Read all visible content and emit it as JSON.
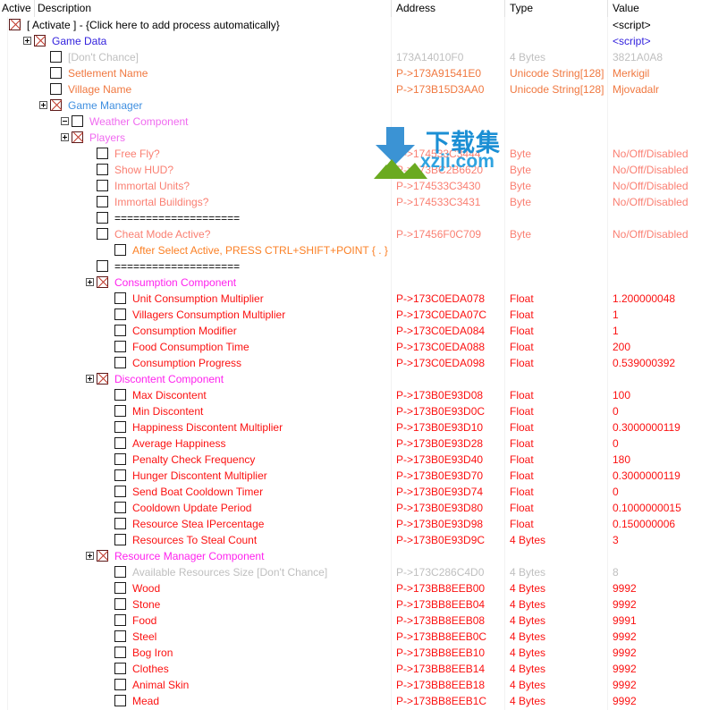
{
  "header": {
    "columns": [
      {
        "key": "active",
        "label": "Active"
      },
      {
        "key": "description",
        "label": "Description"
      },
      {
        "key": "address",
        "label": "Address"
      },
      {
        "key": "type",
        "label": "Type"
      },
      {
        "key": "value",
        "label": "Value"
      }
    ]
  },
  "colors": {
    "group_blue_violet": "#3322dd",
    "group_blue": "#3f8fe0",
    "group_violet": "#f06af0",
    "group_magenta": "#ff22ee",
    "entry_orange": "#f07840",
    "entry_salmon": "#fa7f72",
    "entry_red": "#fb1111",
    "entry_orange_bright": "#fb8026",
    "disabled_gray": "#bfbfbf",
    "text_black": "#000000",
    "check_red": "#c0392b",
    "watermark_blue": "#1b8fd4",
    "watermark_green": "#6aaa20"
  },
  "watermark": {
    "text_cn": "下载集",
    "text_url": "xzji.com"
  },
  "rows": [
    {
      "indent": 0,
      "checkbox": "x",
      "expander": null,
      "description": "[ Activate ] - {Click here to add process automatically}",
      "color": "text_black",
      "address": "",
      "type": "",
      "value": "<script>",
      "value_color": "text_black"
    },
    {
      "indent": 1,
      "checkbox": "x",
      "expander": "plus",
      "description": "Game Data",
      "color": "group_blue_violet",
      "address": "",
      "type": "",
      "value": "<script>",
      "value_color": "group_blue_violet"
    },
    {
      "indent": 2,
      "checkbox": "empty",
      "expander": null,
      "description": "[Don't Chance]",
      "color": "disabled_gray",
      "address": "173A14010F0",
      "type": "4 Bytes",
      "value": "3821A0A8",
      "value_color": "disabled_gray"
    },
    {
      "indent": 2,
      "checkbox": "empty",
      "expander": null,
      "description": "Setlement Name",
      "color": "entry_orange",
      "address": "P->173A91541E0",
      "type": "Unicode String[128]",
      "value": "Merkigil",
      "value_color": "entry_orange"
    },
    {
      "indent": 2,
      "checkbox": "empty",
      "expander": null,
      "description": "Village Name",
      "color": "entry_orange",
      "address": "P->173B15D3AA0",
      "type": "Unicode String[128]",
      "value": "Mjovadalr",
      "value_color": "entry_orange"
    },
    {
      "indent": 2,
      "checkbox": "x",
      "expander": "plus",
      "description": "Game Manager",
      "color": "group_blue",
      "address": "",
      "type": "",
      "value": "",
      "value_color": "group_blue"
    },
    {
      "indent": 3,
      "checkbox": "empty",
      "expander": "minus",
      "description": "Weather Component",
      "color": "group_violet",
      "address": "",
      "type": "",
      "value": "",
      "value_color": "group_violet"
    },
    {
      "indent": 3,
      "checkbox": "x",
      "expander": "plus",
      "description": "Players",
      "color": "group_violet",
      "address": "",
      "type": "",
      "value": "",
      "value_color": "group_violet"
    },
    {
      "indent": 4,
      "checkbox": "empty",
      "expander": null,
      "description": "Free Fly?",
      "color": "entry_salmon",
      "address": "P->174533C3444",
      "type": "Byte",
      "value": "No/Off/Disabled",
      "value_color": "entry_salmon"
    },
    {
      "indent": 4,
      "checkbox": "empty",
      "expander": null,
      "description": "Show HUD?",
      "color": "entry_salmon",
      "address": "P->173BC2B6620",
      "type": "Byte",
      "value": "No/Off/Disabled",
      "value_color": "entry_salmon"
    },
    {
      "indent": 4,
      "checkbox": "empty",
      "expander": null,
      "description": "Immortal Units?",
      "color": "entry_salmon",
      "address": "P->174533C3430",
      "type": "Byte",
      "value": "No/Off/Disabled",
      "value_color": "entry_salmon"
    },
    {
      "indent": 4,
      "checkbox": "empty",
      "expander": null,
      "description": "Immortal Buildings?",
      "color": "entry_salmon",
      "address": "P->174533C3431",
      "type": "Byte",
      "value": "No/Off/Disabled",
      "value_color": "entry_salmon"
    },
    {
      "indent": 4,
      "checkbox": "empty",
      "expander": null,
      "description": "====================",
      "color": "text_black",
      "address": "",
      "type": "",
      "value": "",
      "value_color": "text_black"
    },
    {
      "indent": 4,
      "checkbox": "empty",
      "expander": null,
      "description": "Cheat Mode Active?",
      "color": "entry_salmon",
      "address": "P->17456F0C709",
      "type": "Byte",
      "value": "No/Off/Disabled",
      "value_color": "entry_salmon"
    },
    {
      "indent": 5,
      "checkbox": "empty",
      "expander": null,
      "description": "After Select Active, PRESS CTRL+SHIFT+POINT { . }",
      "color": "entry_orange_bright",
      "address": "",
      "type": "",
      "value": "",
      "value_color": "entry_orange_bright"
    },
    {
      "indent": 4,
      "checkbox": "empty",
      "expander": null,
      "description": "====================",
      "color": "text_black",
      "address": "",
      "type": "",
      "value": "",
      "value_color": "text_black"
    },
    {
      "indent": 4,
      "checkbox": "x",
      "expander": "plus",
      "description": "Consumption Component",
      "color": "group_magenta",
      "address": "",
      "type": "",
      "value": "",
      "value_color": "group_magenta"
    },
    {
      "indent": 5,
      "checkbox": "empty",
      "expander": null,
      "description": "Unit Consumption Multiplier",
      "color": "entry_red",
      "address": "P->173C0EDA078",
      "type": "Float",
      "value": "1.200000048",
      "value_color": "entry_red"
    },
    {
      "indent": 5,
      "checkbox": "empty",
      "expander": null,
      "description": "Villagers Consumption Multiplier",
      "color": "entry_red",
      "address": "P->173C0EDA07C",
      "type": "Float",
      "value": "1",
      "value_color": "entry_red"
    },
    {
      "indent": 5,
      "checkbox": "empty",
      "expander": null,
      "description": "Consumption Modifier",
      "color": "entry_red",
      "address": "P->173C0EDA084",
      "type": "Float",
      "value": "1",
      "value_color": "entry_red"
    },
    {
      "indent": 5,
      "checkbox": "empty",
      "expander": null,
      "description": "Food Consumption Time",
      "color": "entry_red",
      "address": "P->173C0EDA088",
      "type": "Float",
      "value": "200",
      "value_color": "entry_red"
    },
    {
      "indent": 5,
      "checkbox": "empty",
      "expander": null,
      "description": "Consumption Progress",
      "color": "entry_red",
      "address": "P->173C0EDA098",
      "type": "Float",
      "value": "0.539000392",
      "value_color": "entry_red"
    },
    {
      "indent": 4,
      "checkbox": "x",
      "expander": "plus",
      "description": "Discontent Component",
      "color": "group_magenta",
      "address": "",
      "type": "",
      "value": "",
      "value_color": "group_magenta"
    },
    {
      "indent": 5,
      "checkbox": "empty",
      "expander": null,
      "description": "Max Discontent",
      "color": "entry_red",
      "address": "P->173B0E93D08",
      "type": "Float",
      "value": "100",
      "value_color": "entry_red"
    },
    {
      "indent": 5,
      "checkbox": "empty",
      "expander": null,
      "description": "Min Discontent",
      "color": "entry_red",
      "address": "P->173B0E93D0C",
      "type": "Float",
      "value": "0",
      "value_color": "entry_red"
    },
    {
      "indent": 5,
      "checkbox": "empty",
      "expander": null,
      "description": "Happiness Discontent Multiplier",
      "color": "entry_red",
      "address": "P->173B0E93D10",
      "type": "Float",
      "value": "0.3000000119",
      "value_color": "entry_red"
    },
    {
      "indent": 5,
      "checkbox": "empty",
      "expander": null,
      "description": "Average Happiness",
      "color": "entry_red",
      "address": "P->173B0E93D28",
      "type": "Float",
      "value": "0",
      "value_color": "entry_red"
    },
    {
      "indent": 5,
      "checkbox": "empty",
      "expander": null,
      "description": "Penalty Check Frequency",
      "color": "entry_red",
      "address": "P->173B0E93D40",
      "type": "Float",
      "value": "180",
      "value_color": "entry_red"
    },
    {
      "indent": 5,
      "checkbox": "empty",
      "expander": null,
      "description": "Hunger Discontent Multiplier",
      "color": "entry_red",
      "address": "P->173B0E93D70",
      "type": "Float",
      "value": "0.3000000119",
      "value_color": "entry_red"
    },
    {
      "indent": 5,
      "checkbox": "empty",
      "expander": null,
      "description": "Send Boat Cooldown Timer",
      "color": "entry_red",
      "address": "P->173B0E93D74",
      "type": "Float",
      "value": "0",
      "value_color": "entry_red"
    },
    {
      "indent": 5,
      "checkbox": "empty",
      "expander": null,
      "description": "Cooldown Update Period",
      "color": "entry_red",
      "address": "P->173B0E93D80",
      "type": "Float",
      "value": "0.1000000015",
      "value_color": "entry_red"
    },
    {
      "indent": 5,
      "checkbox": "empty",
      "expander": null,
      "description": "Resource Stea IPercentage",
      "color": "entry_red",
      "address": "P->173B0E93D98",
      "type": "Float",
      "value": "0.150000006",
      "value_color": "entry_red"
    },
    {
      "indent": 5,
      "checkbox": "empty",
      "expander": null,
      "description": "Resources To Steal Count",
      "color": "entry_red",
      "address": "P->173B0E93D9C",
      "type": "4 Bytes",
      "value": "3",
      "value_color": "entry_red"
    },
    {
      "indent": 4,
      "checkbox": "x",
      "expander": "plus",
      "description": "Resource Manager Component",
      "color": "group_magenta",
      "address": "",
      "type": "",
      "value": "",
      "value_color": "group_magenta"
    },
    {
      "indent": 5,
      "checkbox": "empty",
      "expander": null,
      "description": "Available Resources Size [Don't Chance]",
      "color": "disabled_gray",
      "address": "P->173C286C4D0",
      "type": "4 Bytes",
      "value": "8",
      "value_color": "disabled_gray"
    },
    {
      "indent": 5,
      "checkbox": "empty",
      "expander": null,
      "description": "Wood",
      "color": "entry_red",
      "address": "P->173BB8EEB00",
      "type": "4 Bytes",
      "value": "9992",
      "value_color": "entry_red"
    },
    {
      "indent": 5,
      "checkbox": "empty",
      "expander": null,
      "description": "Stone",
      "color": "entry_red",
      "address": "P->173BB8EEB04",
      "type": "4 Bytes",
      "value": "9992",
      "value_color": "entry_red"
    },
    {
      "indent": 5,
      "checkbox": "empty",
      "expander": null,
      "description": "Food",
      "color": "entry_red",
      "address": "P->173BB8EEB08",
      "type": "4 Bytes",
      "value": "9991",
      "value_color": "entry_red"
    },
    {
      "indent": 5,
      "checkbox": "empty",
      "expander": null,
      "description": "Steel",
      "color": "entry_red",
      "address": "P->173BB8EEB0C",
      "type": "4 Bytes",
      "value": "9992",
      "value_color": "entry_red"
    },
    {
      "indent": 5,
      "checkbox": "empty",
      "expander": null,
      "description": "Bog Iron",
      "color": "entry_red",
      "address": "P->173BB8EEB10",
      "type": "4 Bytes",
      "value": "9992",
      "value_color": "entry_red"
    },
    {
      "indent": 5,
      "checkbox": "empty",
      "expander": null,
      "description": "Clothes",
      "color": "entry_red",
      "address": "P->173BB8EEB14",
      "type": "4 Bytes",
      "value": "9992",
      "value_color": "entry_red"
    },
    {
      "indent": 5,
      "checkbox": "empty",
      "expander": null,
      "description": "Animal Skin",
      "color": "entry_red",
      "address": "P->173BB8EEB18",
      "type": "4 Bytes",
      "value": "9992",
      "value_color": "entry_red"
    },
    {
      "indent": 5,
      "checkbox": "empty",
      "expander": null,
      "description": "Mead",
      "color": "entry_red",
      "address": "P->173BB8EEB1C",
      "type": "4 Bytes",
      "value": "9992",
      "value_color": "entry_red"
    }
  ]
}
